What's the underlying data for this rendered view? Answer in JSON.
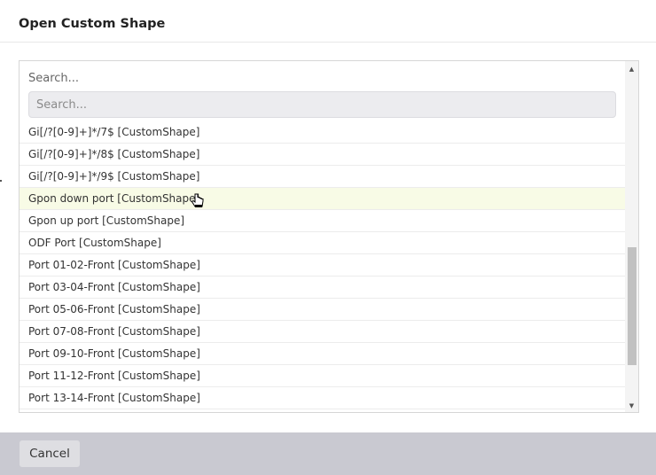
{
  "dialog": {
    "title": "Open Custom Shape",
    "cancel_label": "Cancel"
  },
  "search": {
    "label": "Search...",
    "placeholder": "Search...",
    "value": ""
  },
  "list": {
    "hovered_index": 3,
    "items": [
      "Gi[/?[0-9]+]*/7$ [CustomShape]",
      "Gi[/?[0-9]+]*/8$ [CustomShape]",
      "Gi[/?[0-9]+]*/9$ [CustomShape]",
      "Gpon down port [CustomShape]",
      "Gpon up port [CustomShape]",
      "ODF Port [CustomShape]",
      "Port 01-02-Front [CustomShape]",
      "Port 03-04-Front [CustomShape]",
      "Port 05-06-Front [CustomShape]",
      "Port 07-08-Front [CustomShape]",
      "Port 09-10-Front [CustomShape]",
      "Port 11-12-Front [CustomShape]",
      "Port 13-14-Front [CustomShape]"
    ]
  },
  "colors": {
    "hover_row": "#f8fbe6",
    "footer": "#c9c9d1",
    "scroll_thumb": "#c1c1c1"
  },
  "icons": {
    "scroll_up": "scroll-up-arrow-icon",
    "scroll_down": "scroll-down-arrow-icon",
    "cursor": "hand-pointer-cursor-icon"
  }
}
